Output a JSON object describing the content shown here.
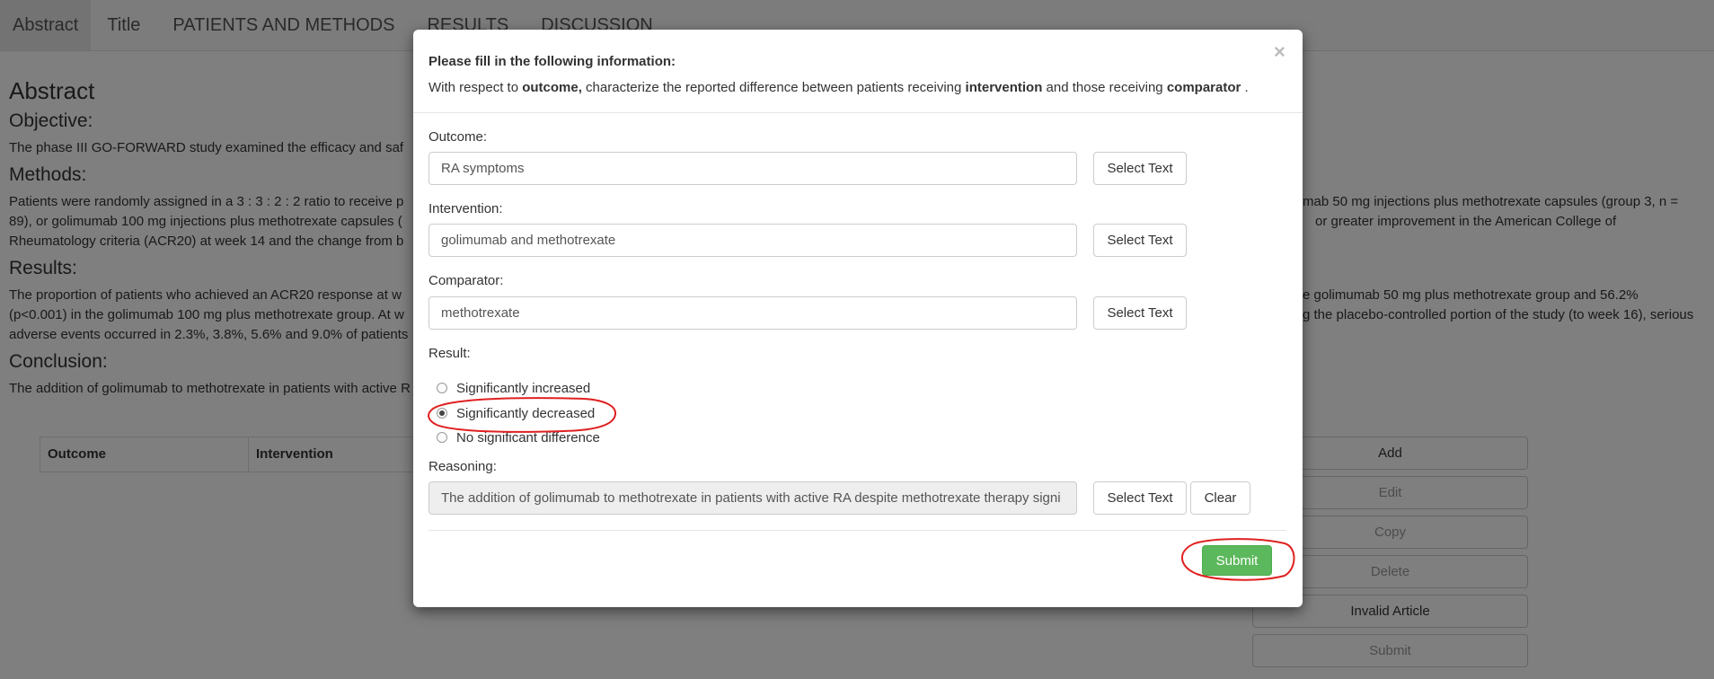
{
  "nav": {
    "tabs": [
      "Abstract",
      "Title",
      "PATIENTS AND METHODS",
      "RESULTS",
      "DISCUSSION"
    ]
  },
  "abstract": {
    "heading": "Abstract",
    "objective_heading": "Objective:",
    "objective_text": "The phase III GO-FORWARD study examined the efficacy and saf",
    "methods_heading": "Methods:",
    "methods_line1_left": "Patients were randomly assigned in a 3 : 3 : 2 : 2 ratio to receive p",
    "methods_line1_right": "mab 50 mg injections plus methotrexate capsules (group 3, n =",
    "methods_line2_left": "89), or golimumab 100 mg injections plus methotrexate capsules (",
    "methods_line2_right": "or greater improvement in the American College of",
    "methods_line3": "Rheumatology criteria (ACR20) at week 14 and the change from b",
    "results_heading": "Results:",
    "results_line1_left": "The proportion of patients who achieved an ACR20 response at w",
    "results_line1_right": "e golimumab 50 mg plus methotrexate group and 56.2%",
    "results_line2_left": "(p<0.001) in the golimumab 100 mg plus methotrexate group. At w",
    "results_line2_right": "g the placebo-controlled portion of the study (to week 16), serious",
    "results_line3": "adverse events occurred in 2.3%, 3.8%, 5.6% and 9.0% of patients",
    "conclusion_heading": "Conclusion:",
    "conclusion_text": "The addition of golimumab to methotrexate in patients with active R"
  },
  "table": {
    "headers": [
      "Outcome",
      "Intervention"
    ]
  },
  "actions": [
    "Add",
    "Edit",
    "Copy",
    "Delete",
    "Invalid Article",
    "Submit"
  ],
  "modal": {
    "title": "Please fill in the following information:",
    "sub_pre": "With respect to ",
    "sub_outcome": "outcome,",
    "sub_mid": " characterize the reported difference between patients receiving ",
    "sub_intervention": "intervention",
    "sub_mid2": " and those receiving ",
    "sub_comparator": "comparator",
    "sub_end": " .",
    "close": "×",
    "outcome_label": "Outcome:",
    "outcome_value": "RA symptoms",
    "intervention_label": "Intervention:",
    "intervention_value": "golimumab and methotrexate",
    "comparator_label": "Comparator:",
    "comparator_value": "methotrexate",
    "select_text": "Select Text",
    "result_label": "Result:",
    "options": [
      "Significantly increased",
      "Significantly decreased",
      "No significant difference"
    ],
    "selected_option": "Significantly decreased",
    "reasoning_label": "Reasoning:",
    "reasoning_value": "The addition of golimumab to methotrexate in patients with active RA despite methotrexate therapy signi",
    "clear": "Clear",
    "submit": "Submit"
  },
  "colors": {
    "submit_green": "#5cb85c",
    "annotation_red": "#e02020"
  }
}
